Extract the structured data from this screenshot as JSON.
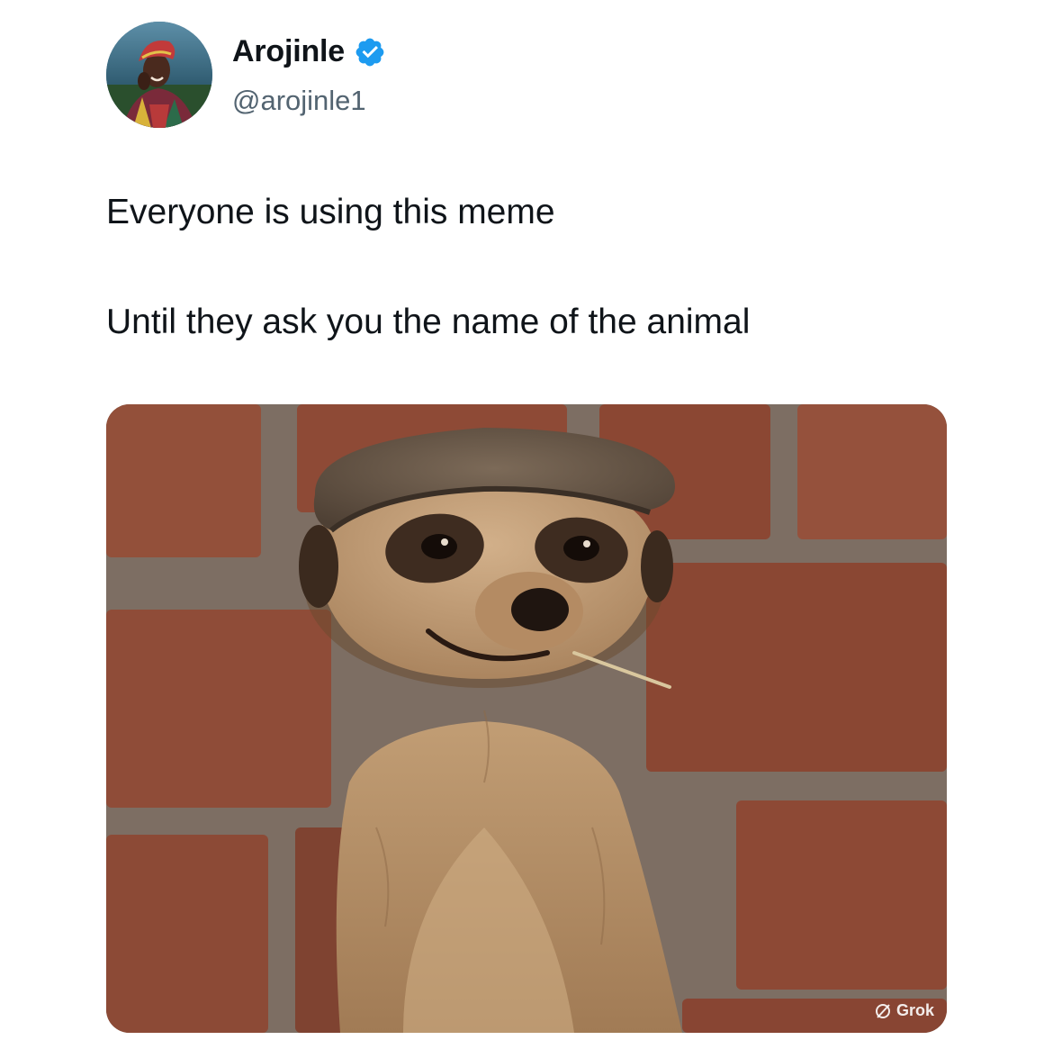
{
  "author": {
    "display_name": "Arojinle",
    "handle": "@arojinle1",
    "verified_icon": "verified-badge-icon",
    "accent_color": "#1d9bf0"
  },
  "tweet": {
    "line1": "Everyone is using this meme",
    "line2": "Until they ask you the name of the animal"
  },
  "media": {
    "watermark": "Grok",
    "watermark_icon": "grok-icon"
  }
}
